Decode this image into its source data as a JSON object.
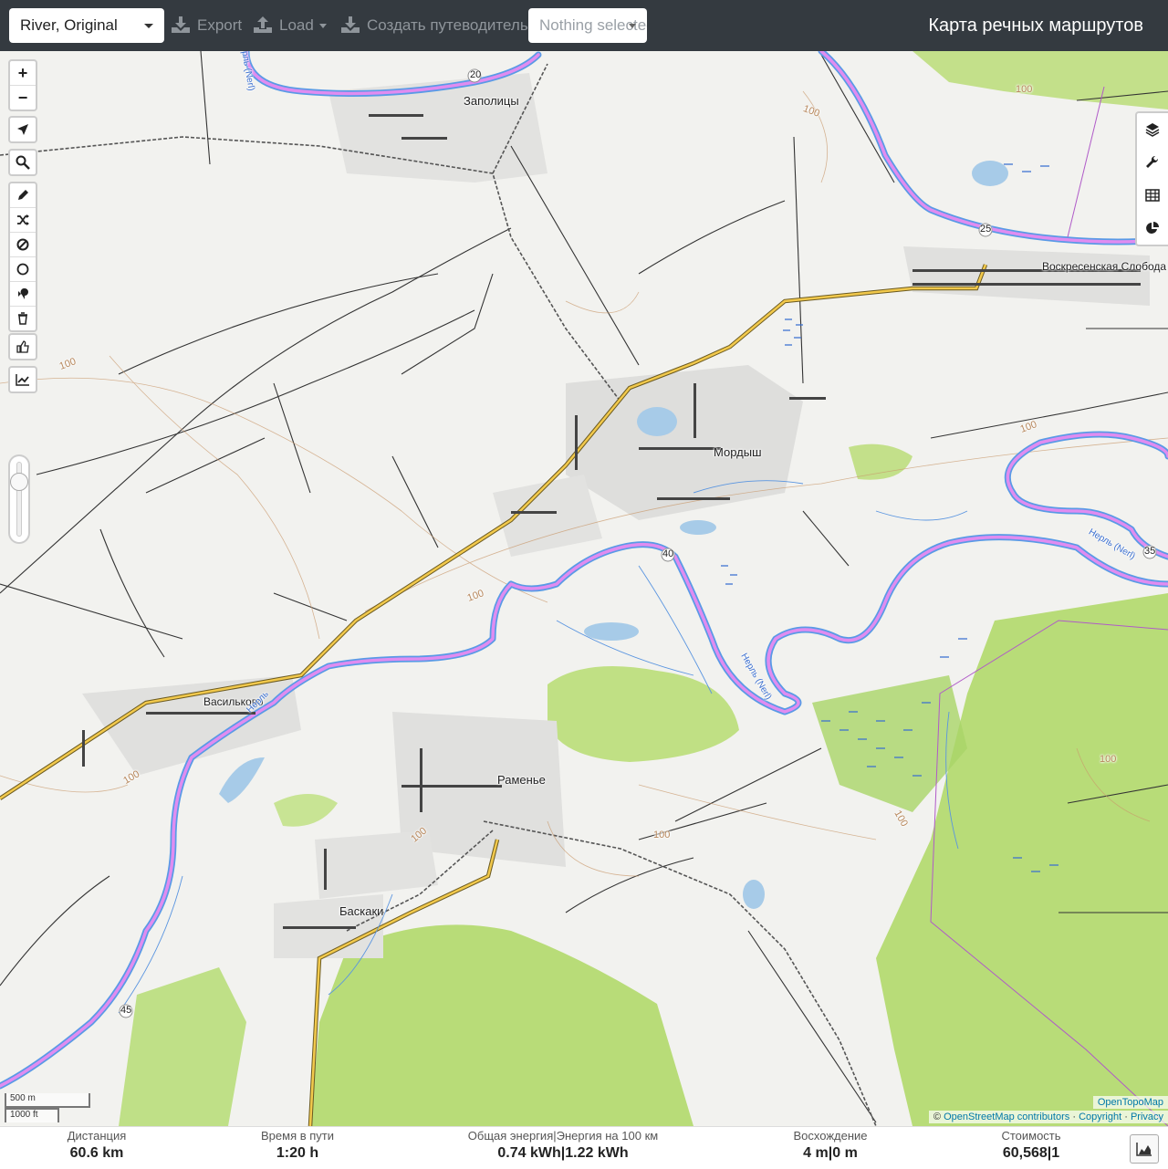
{
  "header": {
    "profile": "River, Original",
    "export_label": "Export",
    "load_label": "Load",
    "guide_label": "Создать путеводитель",
    "selection_placeholder": "Nothing selected",
    "app_title": "Карта речных маршрутов"
  },
  "map": {
    "places": {
      "zapolitsy": "Заполицы",
      "voskresenskaya": "Воскресенская Слобода",
      "mordysh": "Мордыш",
      "vasilkovo": "Васильково",
      "ramenye": "Раменье",
      "baskaki": "Баскаки"
    },
    "river_labels": {
      "nerl_top": "Нерль (Nerl)",
      "nerl_east": "Нерль (Nerl)",
      "nerl_center": "Нерль (Nerl)",
      "nerl_west": "Нерль"
    },
    "route_numbers": [
      "20",
      "25",
      "35",
      "40",
      "45"
    ],
    "contours": [
      "100",
      "100",
      "100",
      "100",
      "100",
      "100",
      "100",
      "100",
      "100",
      "100"
    ],
    "scale": {
      "metric": "500 m",
      "imperial": "1000 ft"
    },
    "attribution": {
      "opentopomap": "OpenTopoMap",
      "prefix": "©",
      "osm": "OpenStreetMap contributors",
      "sep1": "·",
      "copyright": "Copyright",
      "sep2": "·",
      "privacy": "Privacy"
    },
    "controls": {
      "zoom_in": "+",
      "zoom_out": "−"
    }
  },
  "stats": {
    "distance": {
      "label": "Дистанция",
      "value": "60.6",
      "unit": "km"
    },
    "time": {
      "label": "Время в пути",
      "value": "1:20",
      "unit": "h"
    },
    "energy": {
      "label": "Общая энергия|Энергия на 100 км",
      "value1": "0.74",
      "unit1": "kWh",
      "sep": "|",
      "value2": "1.22",
      "unit2": "kWh"
    },
    "ascent": {
      "label": "Восхождение",
      "value1": "4",
      "unit1": "m",
      "sep": "|",
      "value2": "0",
      "unit2": "m"
    },
    "cost": {
      "label": "Стоимость",
      "value1": "60,568",
      "sep": "|",
      "value2": "1"
    }
  },
  "colors": {
    "topbar": "#343a40",
    "route": "#e08cf0",
    "river": "#5aa0e6",
    "forest": "#b5dc74",
    "road": "#d6b24a"
  }
}
